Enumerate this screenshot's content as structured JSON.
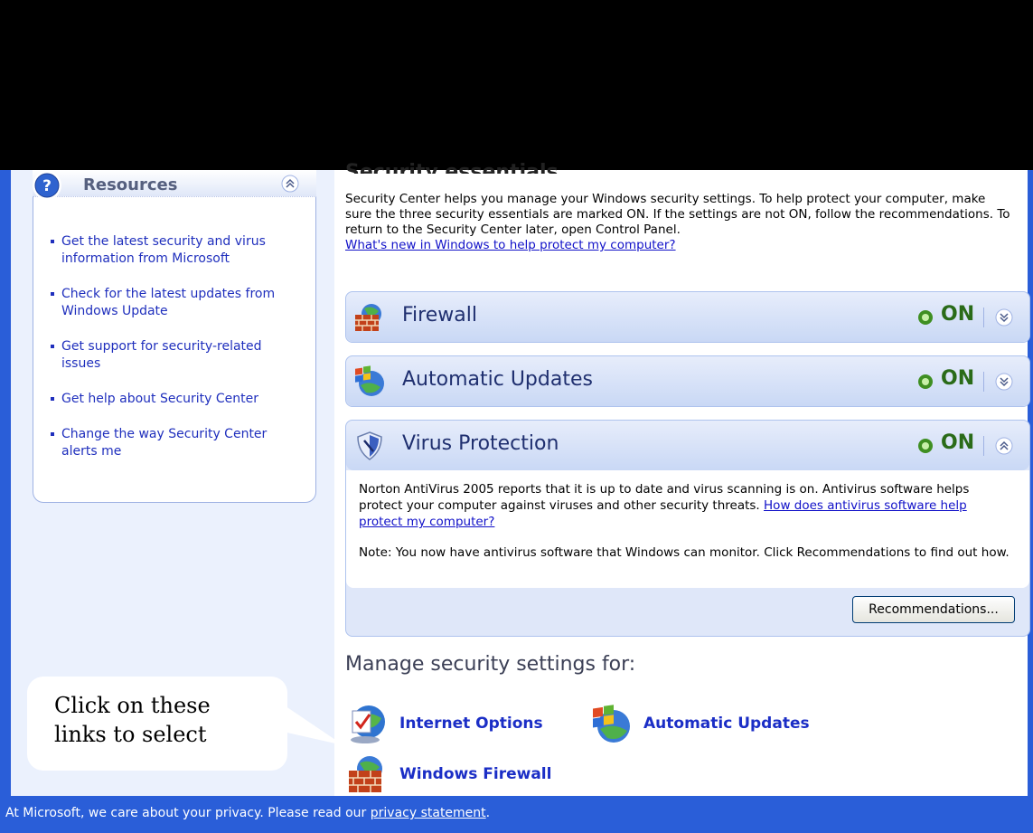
{
  "resources": {
    "title": "Resources",
    "items": [
      "Get the latest security and virus information from Microsoft",
      "Check for the latest updates from Windows Update",
      "Get support for security-related issues",
      "Get help about Security Center",
      "Change the way Security Center alerts me"
    ]
  },
  "callout": {
    "text": "Click on these links to select"
  },
  "main": {
    "section_title": "Security essentials",
    "intro": "Security Center helps you manage your Windows security settings. To help protect your computer, make sure the three security essentials are marked ON. If the settings are not ON, follow the recommendations. To return to the Security Center later, open Control Panel.",
    "intro_link": "What's new in Windows to help protect my computer?",
    "essentials": [
      {
        "title": "Firewall",
        "status": "ON",
        "icon": "firewall-icon"
      },
      {
        "title": "Automatic Updates",
        "status": "ON",
        "icon": "windows-update-icon"
      },
      {
        "title": "Virus Protection",
        "status": "ON",
        "icon": "shield-icon",
        "body_text": "Norton AntiVirus 2005 reports that it is up to date and virus scanning is on. Antivirus software helps protect your computer against viruses and other security threats.",
        "body_link": "How does antivirus software help protect my computer?",
        "note": "Note: You now have antivirus software that Windows can monitor. Click Recommendations to find out how.",
        "button": "Recommendations..."
      }
    ],
    "manage_title": "Manage security settings for:",
    "manage_links": [
      {
        "label": "Internet Options",
        "icon": "internet-options-icon"
      },
      {
        "label": "Automatic Updates",
        "icon": "windows-update-icon"
      },
      {
        "label": "Windows Firewall",
        "icon": "firewall-icon"
      }
    ]
  },
  "status_bar": {
    "text": "At Microsoft, we care about your privacy.  Please read our ",
    "link": "privacy statement",
    "suffix": "."
  },
  "colors": {
    "frame_blue": "#2a5ed8",
    "link_blue": "#1010c8",
    "status_green": "#2a6b18"
  }
}
